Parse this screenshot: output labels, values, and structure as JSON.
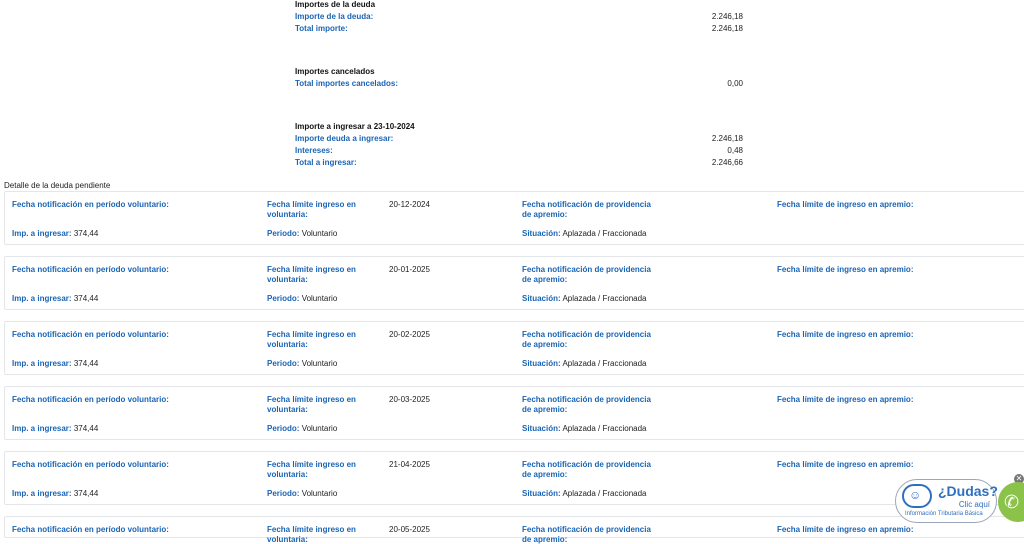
{
  "summary": {
    "debt": {
      "title": "Importes de la deuda",
      "rows": [
        {
          "label": "Importe de la deuda:",
          "value": "2.246,18"
        },
        {
          "label": "Total importe:",
          "value": "2.246,18"
        }
      ]
    },
    "cancelled": {
      "title": "Importes cancelados",
      "rows": [
        {
          "label": "Total importes cancelados:",
          "value": "0,00"
        }
      ]
    },
    "to_pay": {
      "title": "Importe a ingresar a 23-10-2024",
      "rows": [
        {
          "label": "Importe deuda a ingresar:",
          "value": "2.246,18"
        },
        {
          "label": "Intereses:",
          "value": "0,48"
        },
        {
          "label": "Total a ingresar:",
          "value": "2.246,66"
        }
      ]
    }
  },
  "detail": {
    "title": "Detalle de la deuda pendiente",
    "labels": {
      "notif_vol": "Fecha notificación en período voluntario:",
      "limit_vol": "Fecha límite ingreso en voluntaria:",
      "notif_prov": "Fecha notificación de providencia de apremio:",
      "limit_apremio": "Fecha límite de ingreso en apremio:",
      "amount": "Imp. a ingresar:",
      "period": "Periodo:",
      "status": "Situación:"
    },
    "items": [
      {
        "limit_date": "20-12-2024",
        "amount": "374,44",
        "period": "Voluntario",
        "status": "Aplazada / Fraccionada"
      },
      {
        "limit_date": "20-01-2025",
        "amount": "374,44",
        "period": "Voluntario",
        "status": "Aplazada / Fraccionada"
      },
      {
        "limit_date": "20-02-2025",
        "amount": "374,44",
        "period": "Voluntario",
        "status": "Aplazada / Fraccionada"
      },
      {
        "limit_date": "20-03-2025",
        "amount": "374,44",
        "period": "Voluntario",
        "status": "Aplazada / Fraccionada"
      },
      {
        "limit_date": "21-04-2025",
        "amount": "374,44",
        "period": "Voluntario",
        "status": "Aplazada / Fraccionada"
      },
      {
        "limit_date": "20-05-2025"
      }
    ]
  },
  "help_widget": {
    "title": "¿Dudas?",
    "action": "Clic aquí",
    "subtitle": "Información Tributaria Básica",
    "icons": [
      "headset-icon",
      "close-icon",
      "phone-icon"
    ]
  }
}
